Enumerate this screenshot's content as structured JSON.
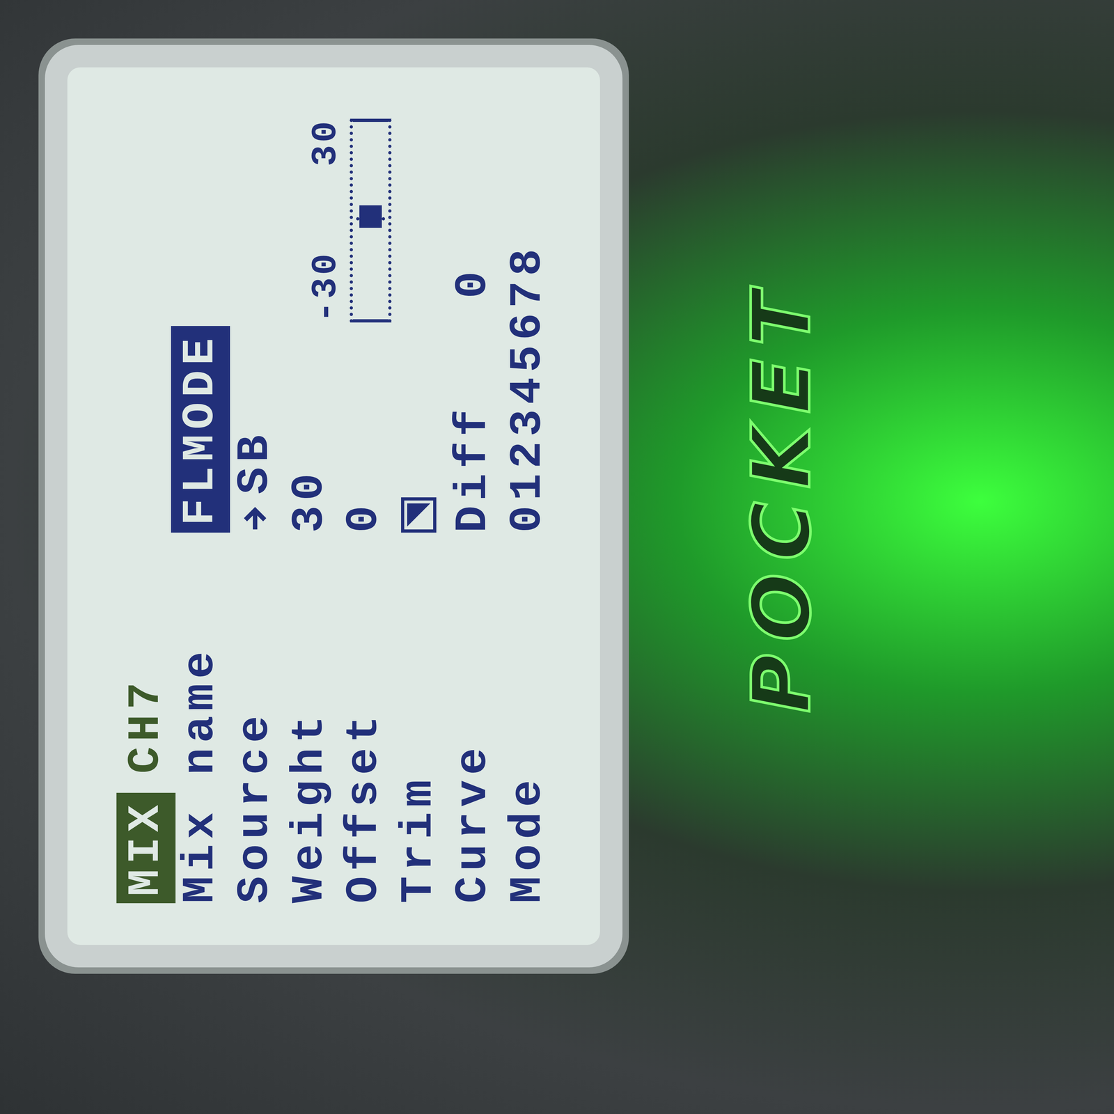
{
  "screen": {
    "header": {
      "title": "MIX",
      "channel": "CH7"
    },
    "rows": [
      {
        "label": "Mix name",
        "kind": "text",
        "value": "FLMODE",
        "selected": true
      },
      {
        "label": "Source",
        "kind": "source",
        "value": "SB",
        "selected": false
      },
      {
        "label": "Weight",
        "kind": "text",
        "value": "30",
        "selected": false
      },
      {
        "label": "Offset",
        "kind": "text",
        "value": "0",
        "selected": false
      },
      {
        "label": "Trim",
        "kind": "checkbox",
        "checked": true,
        "selected": false
      },
      {
        "label": "Curve",
        "kind": "curve",
        "value": "Diff",
        "extra": "0",
        "selected": false
      },
      {
        "label": "Mode",
        "kind": "modes",
        "modes": [
          "0",
          "1",
          "2",
          "3",
          "4",
          "5",
          "6",
          "7",
          "8"
        ],
        "selected": false
      }
    ],
    "gauge": {
      "min": "-30",
      "max": "30",
      "level": 0.52
    }
  },
  "device": {
    "label": "POCKET"
  }
}
